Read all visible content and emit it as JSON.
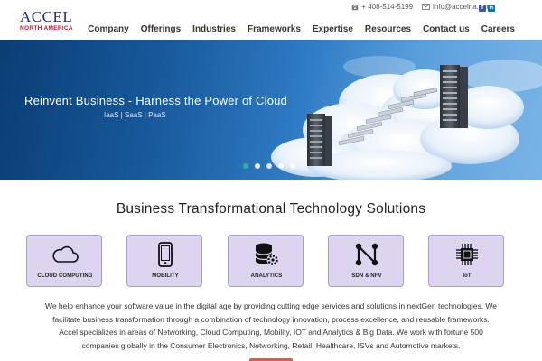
{
  "logo": {
    "main": "ACCEL",
    "sub": "NORTH AMERICA"
  },
  "contact": {
    "phone": "+ 408-514-5199",
    "email": "info@accelna.com",
    "phone_icon": "phone-icon",
    "email_icon": "envelope-icon"
  },
  "social": [
    {
      "name": "facebook-icon",
      "glyph": "f",
      "color": "#3b5998"
    },
    {
      "name": "linkedin-icon",
      "glyph": "in",
      "color": "#0e76a8"
    }
  ],
  "nav": {
    "items": [
      {
        "label": "Company"
      },
      {
        "label": "Offerings"
      },
      {
        "label": "Industries"
      },
      {
        "label": "Frameworks"
      },
      {
        "label": "Expertise"
      },
      {
        "label": "Resources"
      },
      {
        "label": "Contact us"
      },
      {
        "label": "Careers"
      }
    ]
  },
  "hero": {
    "title": "Reinvent Business - Harness the Power of Cloud",
    "subtitle": "IaaS  |  SaaS  |  PaaS",
    "slides": 5,
    "active_slide": 1,
    "active_dot_color": "#2bb3a3"
  },
  "section": {
    "title": "Business Transformational Technology Solutions",
    "cards": [
      {
        "label": "CLOUD COMPUTING",
        "icon": "cloud-icon"
      },
      {
        "label": "MOBILITY",
        "icon": "smartphone-icon"
      },
      {
        "label": "ANALYTICS",
        "icon": "database-gear-icon"
      },
      {
        "label": "SDN & NFV",
        "icon": "network-nodes-icon"
      },
      {
        "label": "IoT",
        "icon": "chip-icon"
      }
    ],
    "card_color": "#ddd5f0"
  },
  "paragraph": [
    "We help enhance your software value in the digital age by providing cutting edge services and solutions in nextGen technologies. We",
    "facilitate business transformation through a combination of technology innovation, process excellence, and reusable frameworks.",
    "Accel specializes in areas of Networking, Cloud Computing, Mobility, IOT and Analytics & Big Data. We work with fortune 500",
    "companies globally in the Consumer Electronics, Networking, Retail, Healthcare, ISVs and Automotive markets."
  ]
}
